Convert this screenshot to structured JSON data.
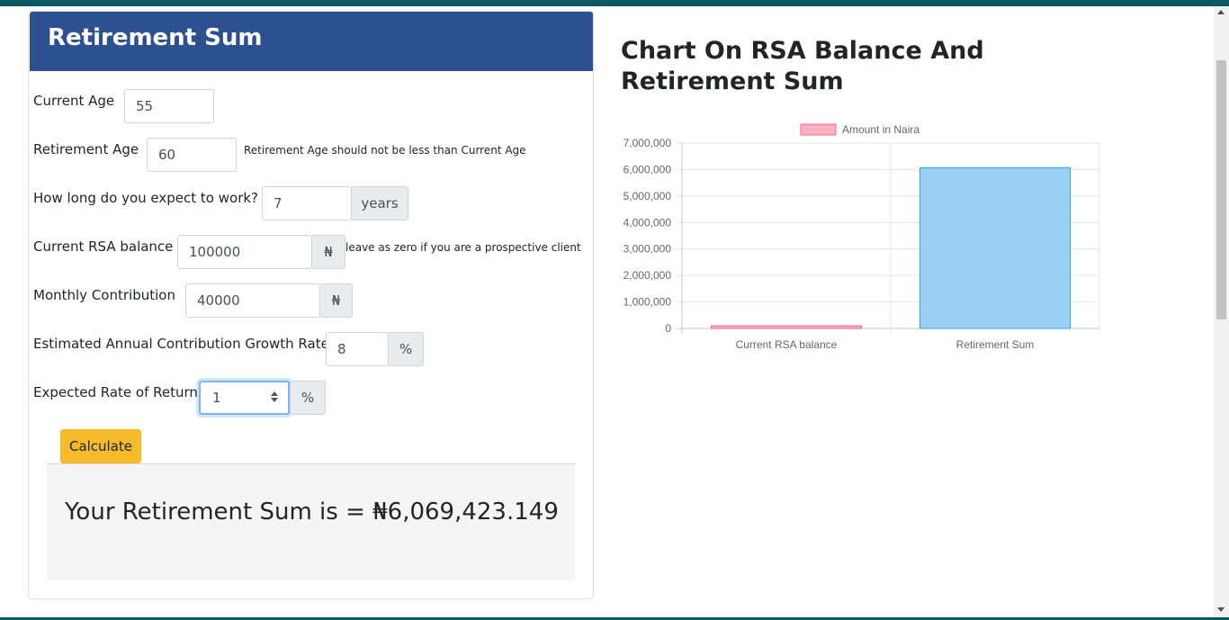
{
  "calculator": {
    "title": "Retirement Sum",
    "fields": [
      {
        "label": "Current Age",
        "value": "55"
      },
      {
        "label": "Retirement Age",
        "value": "60",
        "help": "Retirement Age should not be less than Current Age"
      },
      {
        "label": "How long do you expect to work?",
        "value": "7",
        "addon": "years"
      },
      {
        "label": "Current RSA balance",
        "value": "100000",
        "addon": "₦",
        "help": "leave as zero if you are a prospective client"
      },
      {
        "label": "Monthly Contribution",
        "value": "40000",
        "addon": "₦"
      },
      {
        "label": "Estimated Annual Contribution Growth Rate",
        "value": "8",
        "addon": "%"
      },
      {
        "label": "Expected Rate of Return",
        "value": "1",
        "addon": "%"
      }
    ],
    "calculate_label": "Calculate",
    "result_text": "Your Retirement Sum is = ₦6,069,423.149"
  },
  "chart_section": {
    "heading": "Chart On RSA Balance And Retirement Sum"
  },
  "colors": {
    "header": "#2d5091",
    "button": "#f5bb2b",
    "bar_rsa": "#ffb1c1",
    "bar_sum": "#9ad0f5",
    "top_bar": "#0b5a66"
  },
  "chart_data": {
    "type": "bar",
    "categories": [
      "Current RSA balance",
      "Retirement Sum"
    ],
    "series": [
      {
        "name": "Amount in Naira",
        "values": [
          100000,
          6069423.149
        ],
        "colors": [
          "#ffb1c1",
          "#9ad0f5"
        ],
        "borders": [
          "#ff6384",
          "#36a2eb"
        ]
      }
    ],
    "ylim": [
      0,
      7000000
    ],
    "yticks": [
      0,
      1000000,
      2000000,
      3000000,
      4000000,
      5000000,
      6000000,
      7000000
    ],
    "ytick_labels": [
      "0",
      "1,000,000",
      "2,000,000",
      "3,000,000",
      "4,000,000",
      "5,000,000",
      "6,000,000",
      "7,000,000"
    ],
    "legend_position": "top",
    "grid": true
  }
}
